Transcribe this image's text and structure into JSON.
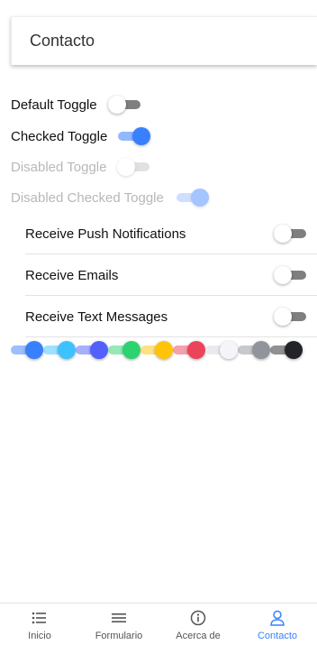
{
  "header": {
    "title": "Contacto"
  },
  "toggles_simple": [
    {
      "label": "Default Toggle",
      "checked": false,
      "disabled": false
    },
    {
      "label": "Checked Toggle",
      "checked": true,
      "disabled": false
    },
    {
      "label": "Disabled Toggle",
      "checked": false,
      "disabled": true
    },
    {
      "label": "Disabled Checked Toggle",
      "checked": true,
      "disabled": true
    }
  ],
  "list": [
    {
      "label": "Receive Push Notifications",
      "checked": false
    },
    {
      "label": "Receive Emails",
      "checked": false
    },
    {
      "label": "Receive Text Messages",
      "checked": false
    }
  ],
  "color_toggles": [
    {
      "color": "primary",
      "hex": "#3880ff"
    },
    {
      "color": "secondary",
      "hex": "#3dc2ff"
    },
    {
      "color": "tertiary",
      "hex": "#5260ff"
    },
    {
      "color": "success",
      "hex": "#2dd36f"
    },
    {
      "color": "warning",
      "hex": "#ffc409"
    },
    {
      "color": "danger",
      "hex": "#eb445a"
    },
    {
      "color": "light",
      "hex": "#f4f5f8"
    },
    {
      "color": "medium",
      "hex": "#92949c"
    },
    {
      "color": "dark",
      "hex": "#222428"
    }
  ],
  "tabs": [
    {
      "label": "Inicio",
      "icon": "list-icon",
      "active": false
    },
    {
      "label": "Formulario",
      "icon": "menu-icon",
      "active": false
    },
    {
      "label": "Acerca de",
      "icon": "info-icon",
      "active": false
    },
    {
      "label": "Contacto",
      "icon": "person-icon",
      "active": true
    }
  ],
  "accent": "#3880ff"
}
